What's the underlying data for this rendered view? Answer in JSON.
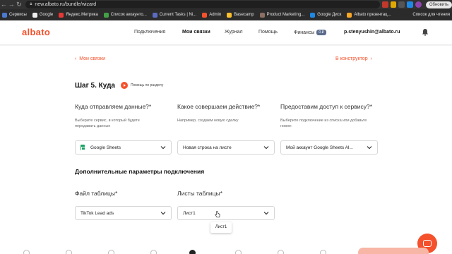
{
  "browser": {
    "url": "new.albato.ru/bundle/wizard",
    "update_label": "Обновить",
    "bookmarks": [
      "Сервисы",
      "Google",
      "Яндекс.Метрика",
      "Список аккаунто...",
      "Current Tasks | Ni...",
      "Admin",
      "Basecamp",
      "Product Marketing...",
      "Google Диск",
      "Albato презентац..."
    ],
    "bookmarks_right": "Список для чтения"
  },
  "header": {
    "logo": "albato",
    "nav": [
      "Подключения",
      "Мои связки",
      "Журнал",
      "Помощь",
      "Финансы"
    ],
    "finance_badge": "0 ₽",
    "user_email": "p.stenyushin@albato.ru"
  },
  "page": {
    "back_link": "Мои связки",
    "constructor_link": "В конструктор",
    "step_title": "Шаг 5. Куда",
    "help_link": "Помощь по разделу",
    "columns": [
      {
        "question": "Куда отправляем данные?*",
        "hint": "Выберите сервис, в который будете передавать данные",
        "value": "Google Sheets"
      },
      {
        "question": "Какое совершаем действие?*",
        "hint": "Например, создаем новую сделку",
        "value": "Новая строка на листе"
      },
      {
        "question": "Предоставим доступ к сервису?*",
        "hint": "Выберите подключение из списка или добавьте новое:",
        "value": "Мой аккаунт Google Sheets Al..."
      }
    ],
    "section_title": "Дополнительные параметры подключения",
    "file_label": "Файл таблицы*",
    "file_value": "TikTok Lead ads",
    "sheets_label": "Листы таблицы*",
    "sheets_value": "Лист1",
    "dropdown_option": "Лист1"
  },
  "colors": {
    "accent": "#f4512c",
    "sheets_green": "#1aa260"
  },
  "icons": [
    "chevron-down-icon",
    "bell-icon",
    "play-icon",
    "chat-icon",
    "lock-icon",
    "google-sheets-icon"
  ]
}
